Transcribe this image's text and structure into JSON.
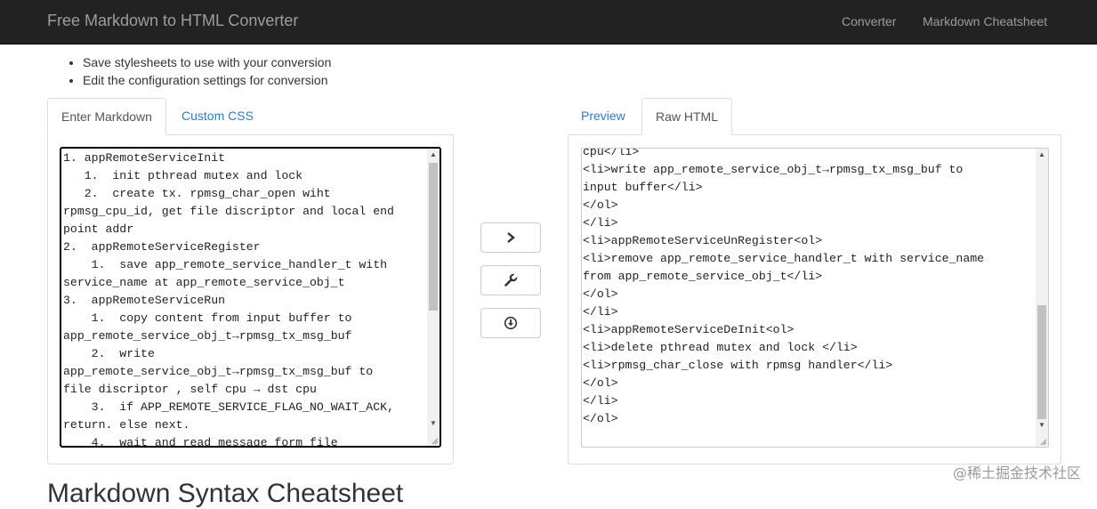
{
  "navbar": {
    "brand": "Free Markdown to HTML Converter",
    "links": [
      "Converter",
      "Markdown Cheatsheet"
    ]
  },
  "features": [
    "Save stylesheets to use with your conversion",
    "Edit the configuration settings for conversion"
  ],
  "left_panel": {
    "tabs": [
      "Enter Markdown",
      "Custom CSS"
    ],
    "active_tab": "Enter Markdown",
    "markdown_lines": [
      "1. appRemoteServiceInit",
      "   1.  init pthread mutex and lock",
      "   2.  create tx. rpmsg_char_open wiht",
      "rpmsg_cpu_id, get file discriptor and local end",
      "point addr",
      "2.  appRemoteServiceRegister",
      "    1.  save app_remote_service_handler_t with",
      "service_name at app_remote_service_obj_t",
      "3.  appRemoteServiceRun",
      "    1.  copy content from input buffer to",
      "app_remote_service_obj_t→rpmsg_tx_msg_buf",
      "    2.  write",
      "app_remote_service_obj_t→rpmsg_tx_msg_buf to",
      "file discriptor , self cpu → dst cpu",
      "    3.  if APP_REMOTE_SERVICE_FLAG_NO_WAIT_ACK,",
      "return. else next.",
      "    4.  wait and read message form file"
    ]
  },
  "actions": {
    "convert_icon": "chevron-right-icon",
    "settings_icon": "wrench-icon",
    "download_icon": "download-icon"
  },
  "right_panel": {
    "tabs": [
      "Preview",
      "Raw HTML"
    ],
    "active_tab": "Raw HTML",
    "html_lines": [
      "cpu</li>",
      "<li>write app_remote_service_obj_t→rpmsg_tx_msg_buf to",
      "input buffer</li>",
      "</ol>",
      "</li>",
      "<li>appRemoteServiceUnRegister<ol>",
      "<li>remove app_remote_service_handler_t with service_name",
      "from app_remote_service_obj_t</li>",
      "</ol>",
      "</li>",
      "<li>appRemoteServiceDeInit<ol>",
      "<li>delete pthread mutex and lock </li>",
      "<li>rpmsg_char_close with rpmsg handler</li>",
      "</ol>",
      "</li>",
      "</ol>"
    ]
  },
  "section_heading": "Markdown Syntax Cheatsheet",
  "watermark": "@稀土掘金技术社区"
}
